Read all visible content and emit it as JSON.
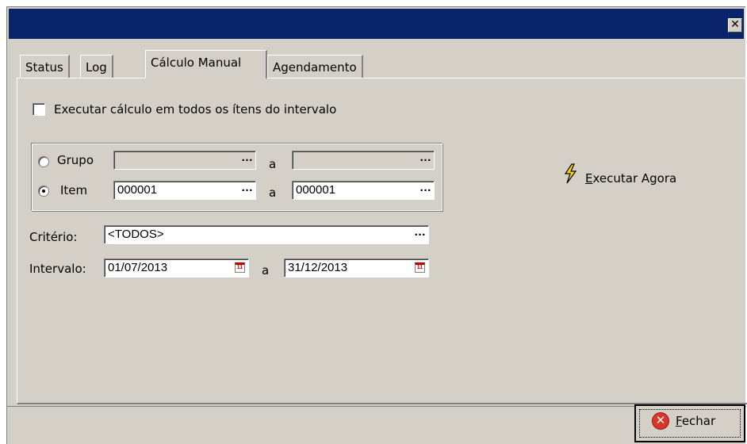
{
  "window": {
    "close_glyph": "✕"
  },
  "tabs": [
    {
      "label": "Status",
      "active": false
    },
    {
      "label": "Log",
      "active": false
    },
    {
      "label": "Cálculo Manual",
      "active": true
    },
    {
      "label": "Agendamento",
      "active": false
    }
  ],
  "form": {
    "execute_all_label": "Executar cálculo em todos os ítens do intervalo",
    "execute_all_checked": false,
    "grupo_label": "Grupo",
    "grupo_from": "",
    "grupo_to": "",
    "item_label": "Item",
    "item_from": "000001",
    "item_to": "000001",
    "range_sep": "a",
    "selected_radio": "item",
    "criterio_label": "Critério:",
    "criterio_value": "<TODOS>",
    "intervalo_label": "Intervalo:",
    "intervalo_from": "01/07/2013",
    "intervalo_to": "31/12/2013",
    "ellipsis": "…",
    "calendar_glyph": "11"
  },
  "actions": {
    "execute_now_prefix": "E",
    "execute_now_rest": "xecutar Agora",
    "close_prefix": "F",
    "close_rest": "echar",
    "close_icon_glyph": "✕",
    "bolt_color": "#ffd800"
  }
}
